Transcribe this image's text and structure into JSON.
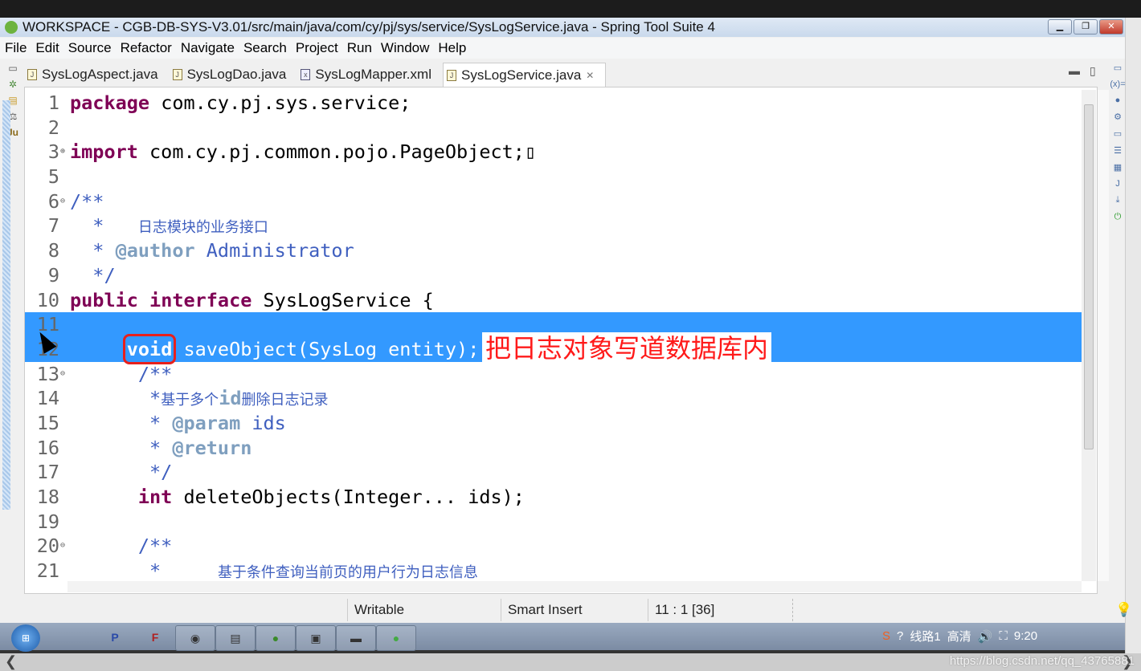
{
  "window": {
    "title": "WORKSPACE - CGB-DB-SYS-V3.01/src/main/java/com/cy/pj/sys/service/SysLogService.java - Spring Tool Suite 4",
    "controls": [
      "minimize",
      "restore",
      "close"
    ]
  },
  "menu": [
    "File",
    "Edit",
    "Source",
    "Refactor",
    "Navigate",
    "Search",
    "Project",
    "Run",
    "Window",
    "Help"
  ],
  "tabs": [
    {
      "label": "SysLogAspect.java",
      "icon": "java-file-icon"
    },
    {
      "label": "SysLogDao.java",
      "icon": "java-file-icon"
    },
    {
      "label": "SysLogMapper.xml",
      "icon": "xml-file-icon"
    },
    {
      "label": "SysLogService.java",
      "icon": "java-file-icon",
      "active": true,
      "close": "✕"
    }
  ],
  "code": [
    {
      "n": "1",
      "t": [
        [
          "kw",
          "package"
        ],
        [
          "plain",
          " com.cy.pj.sys.service;"
        ]
      ]
    },
    {
      "n": "2",
      "t": []
    },
    {
      "n": "3",
      "fold": "⊕",
      "t": [
        [
          "kw",
          "import"
        ],
        [
          "plain",
          " com.cy.pj.common.pojo.PageObject;"
        ],
        [
          "plain",
          "▯"
        ]
      ]
    },
    {
      "n": "5",
      "t": []
    },
    {
      "n": "6",
      "fold": "⊖",
      "t": [
        [
          "cm",
          "/**"
        ]
      ]
    },
    {
      "n": "7",
      "t": [
        [
          "cm",
          "  *   "
        ],
        [
          "zh",
          "日志模块的业务接口"
        ]
      ]
    },
    {
      "n": "8",
      "t": [
        [
          "cm",
          "  * "
        ],
        [
          "tag",
          "@author"
        ],
        [
          "cm",
          " Administrator"
        ]
      ]
    },
    {
      "n": "9",
      "t": [
        [
          "cm",
          "  */"
        ]
      ]
    },
    {
      "n": "10",
      "t": [
        [
          "kw",
          "public"
        ],
        [
          "plain",
          " "
        ],
        [
          "kw",
          "interface"
        ],
        [
          "plain",
          " SysLogService {"
        ]
      ]
    },
    {
      "n": "11",
      "sel": true,
      "t": []
    },
    {
      "n": "12",
      "sel": true,
      "t": [
        [
          "plain",
          "     "
        ],
        [
          "kw boxed",
          "void"
        ],
        [
          "plain",
          " saveObject(SysLog entity);"
        ]
      ]
    },
    {
      "n": "13",
      "fold": "⊖",
      "t": [
        [
          "cm",
          "      /**"
        ]
      ]
    },
    {
      "n": "14",
      "t": [
        [
          "cm",
          "       *"
        ],
        [
          "zh",
          "基于多个"
        ],
        [
          "tag",
          "id"
        ],
        [
          "zh",
          "删除日志记录"
        ]
      ]
    },
    {
      "n": "15",
      "t": [
        [
          "cm",
          "       * "
        ],
        [
          "tag",
          "@param"
        ],
        [
          "cm",
          " ids"
        ]
      ]
    },
    {
      "n": "16",
      "t": [
        [
          "cm",
          "       * "
        ],
        [
          "tag",
          "@return"
        ]
      ]
    },
    {
      "n": "17",
      "t": [
        [
          "cm",
          "       */"
        ]
      ]
    },
    {
      "n": "18",
      "t": [
        [
          "plain",
          "      "
        ],
        [
          "kw",
          "int"
        ],
        [
          "plain",
          " deleteObjects(Integer... ids);"
        ]
      ]
    },
    {
      "n": "19",
      "t": []
    },
    {
      "n": "20",
      "fold": "⊖",
      "t": [
        [
          "cm",
          "      /**"
        ]
      ]
    },
    {
      "n": "21",
      "t": [
        [
          "cm",
          "       *     "
        ],
        [
          "zh",
          "基于条件查询当前页的用户行为日志信息"
        ]
      ]
    }
  ],
  "annotation": "把日志对象写道数据库内",
  "status": {
    "writable": "Writable",
    "insert_mode": "Smart Insert",
    "position": "11 : 1 [36]"
  },
  "taskbar": {
    "apps": [
      "P",
      "F",
      "chrome",
      "files",
      "spring",
      "notepad",
      "window",
      "wechat"
    ],
    "tray": {
      "line": "线路1",
      "quality": "高清",
      "clock": "9:20"
    }
  },
  "watermark": "https://blog.csdn.net/qq_43765881"
}
